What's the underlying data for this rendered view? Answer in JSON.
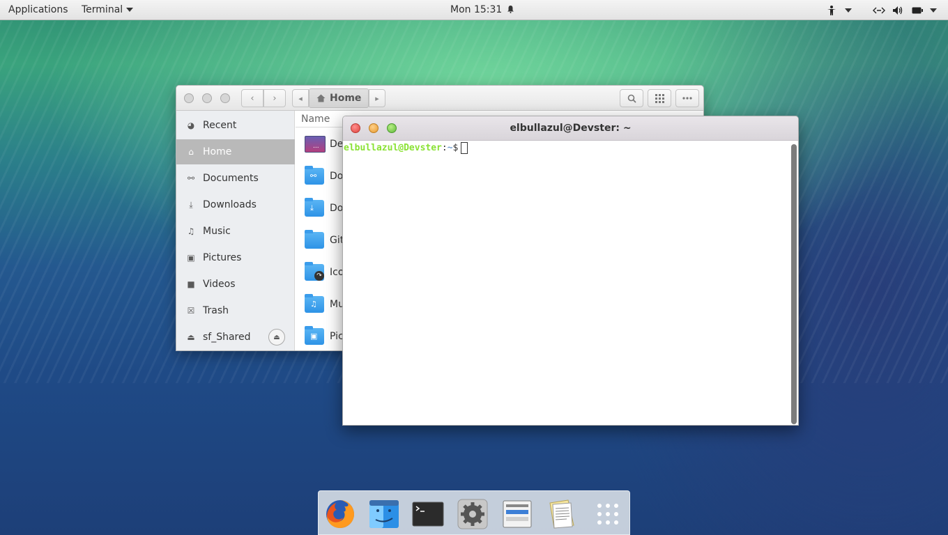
{
  "top_panel": {
    "applications": "Applications",
    "app_menu": "Terminal",
    "clock": "Mon 15:31"
  },
  "files_window": {
    "path_button": "Home",
    "column_name": "Name",
    "sidebar": [
      {
        "label": "Recent",
        "icon": "clock-icon"
      },
      {
        "label": "Home",
        "icon": "home-icon"
      },
      {
        "label": "Documents",
        "icon": "link-icon"
      },
      {
        "label": "Downloads",
        "icon": "download-icon"
      },
      {
        "label": "Music",
        "icon": "music-icon"
      },
      {
        "label": "Pictures",
        "icon": "picture-icon"
      },
      {
        "label": "Videos",
        "icon": "video-icon"
      },
      {
        "label": "Trash",
        "icon": "trash-icon"
      },
      {
        "label": "sf_Shared",
        "icon": "drive-icon"
      }
    ],
    "files": [
      "De",
      "Do",
      "Do",
      "Git",
      "Ico",
      "Mu",
      "Pic"
    ]
  },
  "terminal": {
    "title": "elbullazul@Devster: ~",
    "prompt_user": "elbullazul@Devster",
    "prompt_colon": ":",
    "prompt_path": "~",
    "prompt_dollar": "$"
  },
  "dock": {
    "items": [
      "firefox",
      "finder",
      "terminal",
      "settings",
      "system-monitor",
      "text-editor",
      "app-grid"
    ]
  },
  "colors": {
    "active_sidebar": "#b9b9b9",
    "prompt_user": "#8ae234",
    "prompt_path": "#729fcf"
  }
}
